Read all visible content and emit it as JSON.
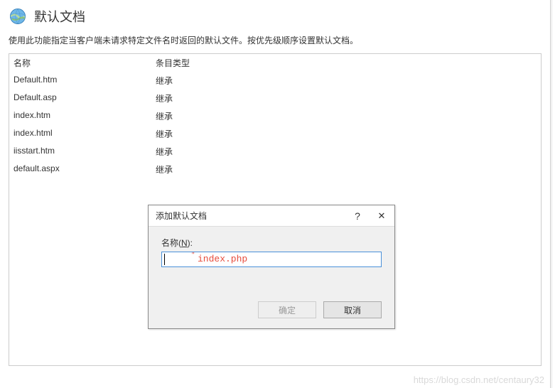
{
  "header": {
    "title": "默认文档",
    "icon": "globe-icon"
  },
  "description": "使用此功能指定当客户端未请求特定文件名时返回的默认文件。按优先级顺序设置默认文档。",
  "table": {
    "columns": {
      "name": "名称",
      "type": "条目类型"
    },
    "rows": [
      {
        "name": "Default.htm",
        "type": "继承"
      },
      {
        "name": "Default.asp",
        "type": "继承"
      },
      {
        "name": "index.htm",
        "type": "继承"
      },
      {
        "name": "index.html",
        "type": "继承"
      },
      {
        "name": "iisstart.htm",
        "type": "继承"
      },
      {
        "name": "default.aspx",
        "type": "继承"
      }
    ]
  },
  "dialog": {
    "title": "添加默认文档",
    "help_icon": "?",
    "close_icon": "✕",
    "field_label_prefix": "名称(",
    "field_label_accel": "N",
    "field_label_suffix": "):",
    "input_value": "",
    "overlay_text": "index.php",
    "ok_label": "确定",
    "cancel_label": "取消"
  },
  "watermark": "https://blog.csdn.net/centaury32"
}
